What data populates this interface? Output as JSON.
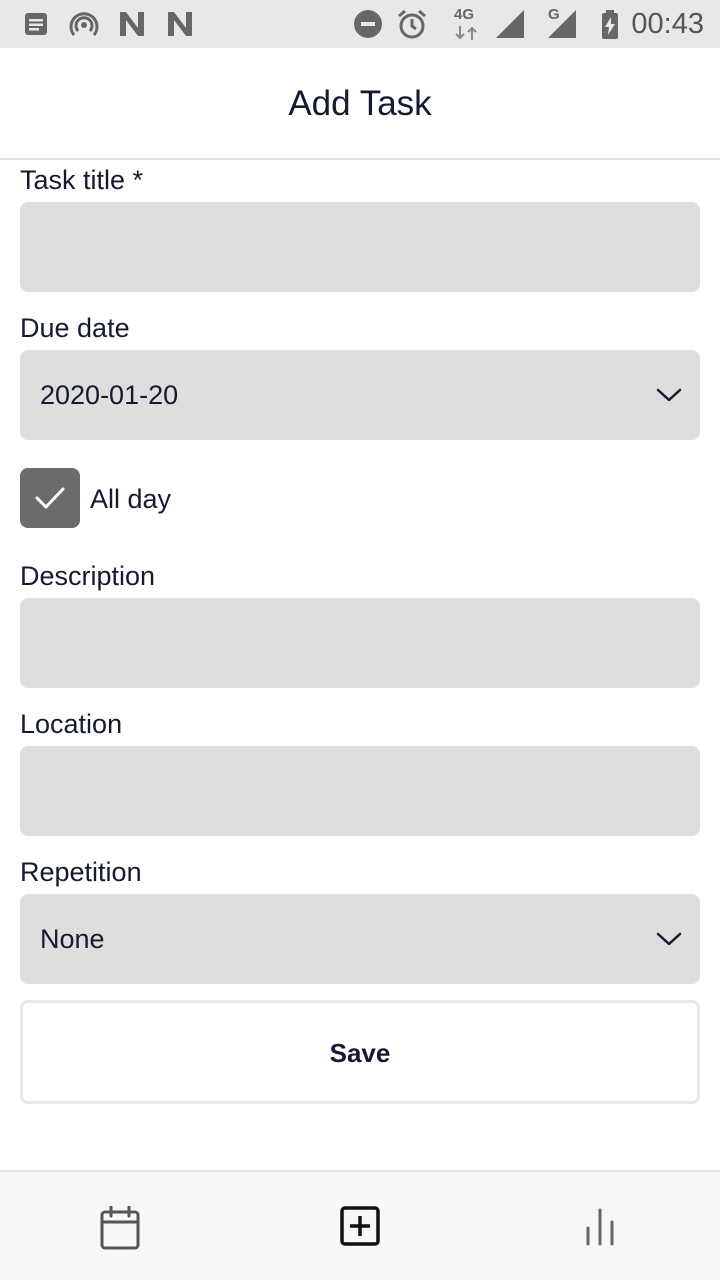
{
  "status_bar": {
    "time": "00:43",
    "network_4g": "4G",
    "network_g": "G",
    "icons": [
      "notes-icon",
      "hotspot-icon",
      "n-icon",
      "n-icon",
      "do-not-disturb-icon",
      "alarm-icon",
      "signal-icon",
      "signal-icon",
      "battery-charging-icon"
    ]
  },
  "header": {
    "title": "Add Task"
  },
  "form": {
    "task_title": {
      "label": "Task title *",
      "value": ""
    },
    "due_date": {
      "label": "Due date",
      "value": "2020-01-20"
    },
    "all_day": {
      "label": "All day",
      "checked": true
    },
    "description": {
      "label": "Description",
      "value": ""
    },
    "location": {
      "label": "Location",
      "value": ""
    },
    "repetition": {
      "label": "Repetition",
      "value": "None"
    },
    "save_label": "Save"
  },
  "bottom_nav": {
    "items": [
      "calendar-icon",
      "add-square-icon",
      "bar-chart-icon"
    ],
    "active_index": 1
  },
  "colors": {
    "field_bg": "#dedede",
    "checkbox_bg": "#6b6b6b",
    "text": "#151a30",
    "nav_bg": "#f7f7f7"
  }
}
